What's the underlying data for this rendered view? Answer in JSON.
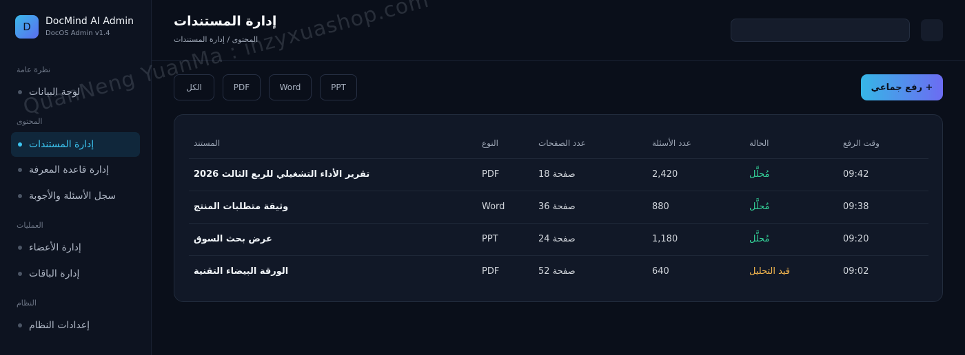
{
  "brand": {
    "logo_letter": "D",
    "name": "DocMind AI Admin",
    "version": "DocOS Admin v1.4"
  },
  "sidebar": {
    "sections": [
      {
        "title": "نظرة عامة"
      },
      {
        "title": "المحتوى"
      },
      {
        "title": "العمليات"
      },
      {
        "title": "النظام"
      }
    ],
    "items": [
      {
        "label": "لوحة البيانات",
        "active": false
      },
      {
        "label": "إدارة المستندات",
        "active": true
      },
      {
        "label": "إدارة قاعدة المعرفة",
        "active": false
      },
      {
        "label": "سجل الأسئلة والأجوبة",
        "active": false
      },
      {
        "label": "إدارة الأعضاء",
        "active": false
      },
      {
        "label": "إدارة الباقات",
        "active": false
      },
      {
        "label": "إعدادات النظام",
        "active": false
      }
    ]
  },
  "header": {
    "title": "إدارة المستندات",
    "breadcrumb": "المحتوى / إدارة المستندات"
  },
  "filters": [
    "الكل",
    "PDF",
    "Word",
    "PPT"
  ],
  "upload_button": "رفع جماعي +",
  "table": {
    "columns": [
      "المستند",
      "النوع",
      "عدد الصفحات",
      "عدد الأسئلة",
      "الحالة",
      "وقت الرفع"
    ],
    "rows": [
      {
        "document": "تقرير الأداء التشغيلي للربع الثالث 2026",
        "type": "PDF",
        "pages": "18 صفحة",
        "questions": "2,420",
        "status": "مُحلَّل",
        "time": "09:42"
      },
      {
        "document": "وثيقة متطلبات المنتج",
        "type": "Word",
        "pages": "36 صفحة",
        "questions": "880",
        "status": "مُحلَّل",
        "time": "09:38"
      },
      {
        "document": "عرض بحث السوق",
        "type": "PPT",
        "pages": "24 صفحة",
        "questions": "1,180",
        "status": "مُحلَّل",
        "time": "09:20"
      },
      {
        "document": "الورقة البيضاء التقنية",
        "type": "PDF",
        "pages": "52 صفحة",
        "questions": "640",
        "status": "قيد التحليل",
        "time": "09:02"
      }
    ]
  },
  "watermark": "QuanNeng YuanMa : inzyxuashop.com",
  "colors": {
    "accent": "#3cc4f0",
    "status_done": "#34d399",
    "status_pending": "#f5b74f"
  }
}
